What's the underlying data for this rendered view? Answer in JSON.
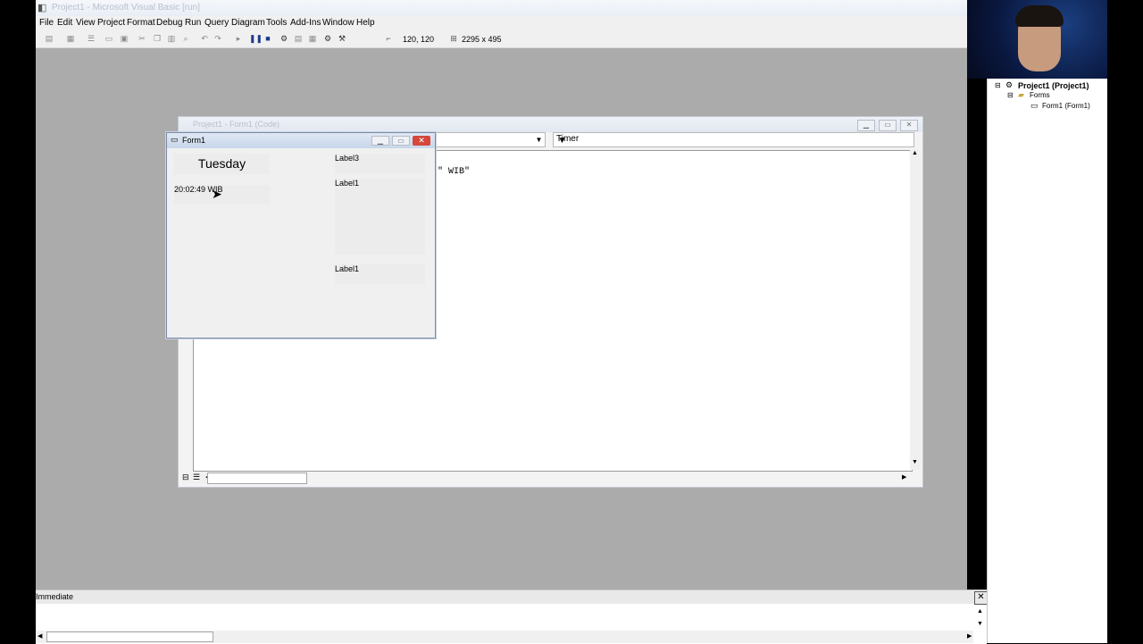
{
  "app": {
    "title": "Project1 - Microsoft Visual Basic [run]"
  },
  "menu": [
    "File",
    "Edit",
    "View",
    "Project",
    "Format",
    "Debug",
    "Run",
    "Query",
    "Diagram",
    "Tools",
    "Add-Ins",
    "Window",
    "Help"
  ],
  "toolbar": {
    "coords": "120, 120",
    "size": "2295 x 495"
  },
  "code_window": {
    "title": "Project1 - Form1 (Code)",
    "object_value": "",
    "procedure_value": "Timer",
    "code_fragment": "- \" WIB\""
  },
  "form1": {
    "title": "Form1",
    "day_label": "Tuesday",
    "time_label": "20:02:49 WIB",
    "label3": "Label3",
    "label1_top": "Label1",
    "label1_bottom": "Label1"
  },
  "immediate": {
    "title": "Immediate"
  },
  "project_explorer": {
    "root": "Project1 (Project1)",
    "folder": "Forms",
    "form": "Form1 (Form1)"
  }
}
